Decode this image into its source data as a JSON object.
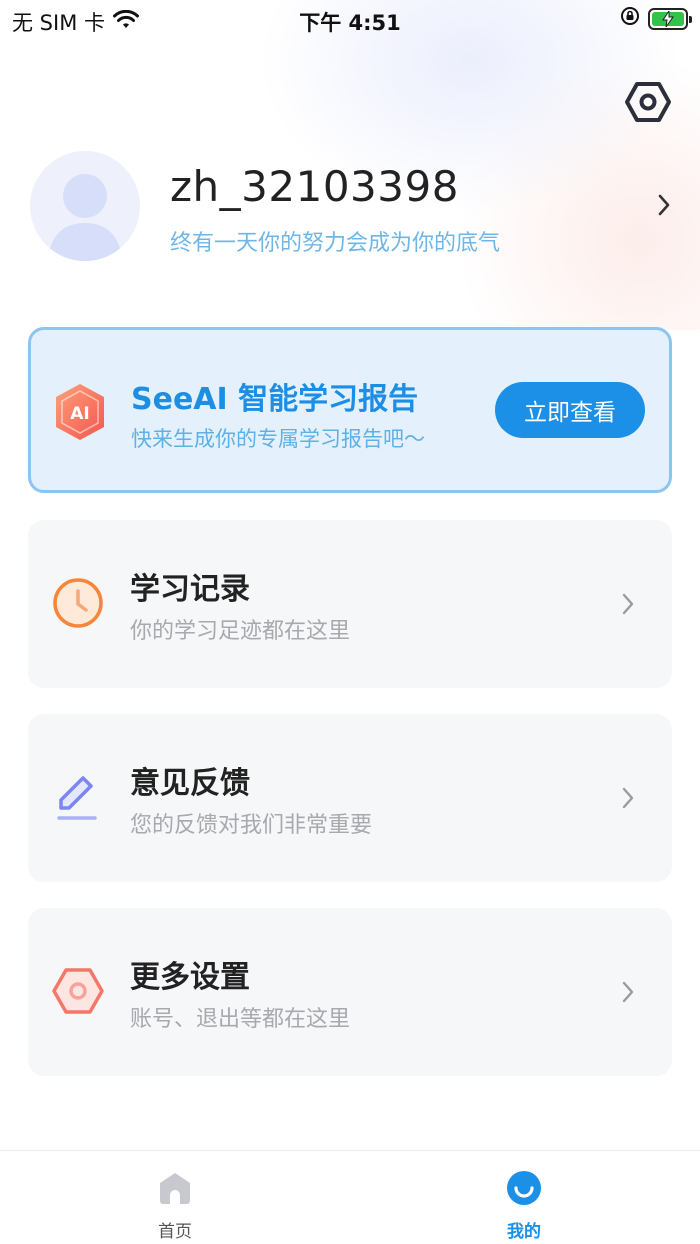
{
  "status_bar": {
    "carrier": "无 SIM 卡",
    "time": "下午 4:51"
  },
  "header": {
    "settings_icon": "hexagon-gear-icon"
  },
  "profile": {
    "username": "zh_32103398",
    "motto": "终有一天你的努力会成为你的底气"
  },
  "ai_report": {
    "title": "SeeAI 智能学习报告",
    "subtitle": "快来生成你的专属学习报告吧～",
    "button_label": "立即查看",
    "icon_text": "AI",
    "accent_color": "#1b90e6"
  },
  "menu": [
    {
      "title": "学习记录",
      "subtitle": "你的学习足迹都在这里",
      "icon": "clock-icon",
      "color": "#f5863a"
    },
    {
      "title": "意见反馈",
      "subtitle": "您的反馈对我们非常重要",
      "icon": "pencil-icon",
      "color": "#7b86f0"
    },
    {
      "title": "更多设置",
      "subtitle": "账号、退出等都在这里",
      "icon": "hexagon-settings-icon",
      "color": "#f4776a"
    }
  ],
  "tabbar": {
    "home_label": "首页",
    "mine_label": "我的",
    "active_tab": "我的"
  }
}
